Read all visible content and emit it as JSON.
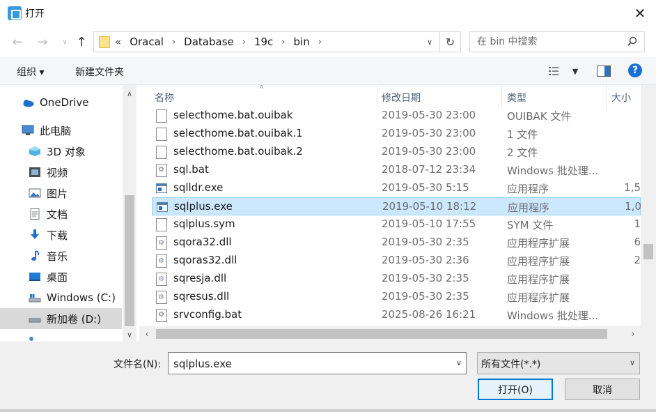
{
  "window": {
    "title": "打开"
  },
  "nav": {
    "breadcrumbs": [
      "«",
      "Oracal",
      "Database",
      "19c",
      "bin"
    ],
    "search_placeholder": "在 bin 中搜索"
  },
  "toolbar": {
    "organize_label": "组织 ▾",
    "new_folder_label": "新建文件夹",
    "help_label": "?"
  },
  "sidebar": {
    "items": [
      {
        "label": "OneDrive",
        "icon": "cloud-icon",
        "color": "#1f6fd1"
      },
      {
        "label": "此电脑",
        "icon": "computer-icon",
        "color": "#4a8bd6"
      },
      {
        "label": "3D 对象",
        "icon": "3d-objects-icon",
        "color": "#4fb3e8"
      },
      {
        "label": "视频",
        "icon": "video-icon",
        "color": "#5b5b5b"
      },
      {
        "label": "图片",
        "icon": "pictures-icon",
        "color": "#7a9ab8"
      },
      {
        "label": "文档",
        "icon": "documents-icon",
        "color": "#8a9bb0"
      },
      {
        "label": "下载",
        "icon": "downloads-icon",
        "color": "#1f6fd1"
      },
      {
        "label": "音乐",
        "icon": "music-icon",
        "color": "#1f6fd1"
      },
      {
        "label": "桌面",
        "icon": "desktop-icon",
        "color": "#1f7fd8"
      },
      {
        "label": "Windows (C:)",
        "icon": "drive-c-icon",
        "color": "#7a8a99"
      },
      {
        "label": "新加卷 (D:)",
        "icon": "drive-d-icon",
        "color": "#6a6a6a"
      }
    ]
  },
  "columns": {
    "name": "名称",
    "date": "修改日期",
    "type": "类型",
    "size": "大小"
  },
  "files": [
    {
      "name": "selecthome.bat.ouibak",
      "date": "2019-05-30 23:00",
      "type": "OUIBAK 文件",
      "size": "",
      "icon": "doc"
    },
    {
      "name": "selecthome.bat.ouibak.1",
      "date": "2019-05-30 23:00",
      "type": "1 文件",
      "size": "",
      "icon": "doc"
    },
    {
      "name": "selecthome.bat.ouibak.2",
      "date": "2019-05-30 23:00",
      "type": "2 文件",
      "size": "",
      "icon": "doc"
    },
    {
      "name": "sql.bat",
      "date": "2018-07-12 23:34",
      "type": "Windows 批处理...",
      "size": "",
      "icon": "bat"
    },
    {
      "name": "sqlldr.exe",
      "date": "2019-05-30 5:15",
      "type": "应用程序",
      "size": "1,5",
      "icon": "exe"
    },
    {
      "name": "sqlplus.exe",
      "date": "2019-05-10 18:12",
      "type": "应用程序",
      "size": "1,0",
      "icon": "exe",
      "selected": true
    },
    {
      "name": "sqlplus.sym",
      "date": "2019-05-10 17:55",
      "type": "SYM 文件",
      "size": "1",
      "icon": "doc"
    },
    {
      "name": "sqora32.dll",
      "date": "2019-05-30 2:35",
      "type": "应用程序扩展",
      "size": "6",
      "icon": "dll"
    },
    {
      "name": "sqoras32.dll",
      "date": "2019-05-30 2:36",
      "type": "应用程序扩展",
      "size": "2",
      "icon": "dll"
    },
    {
      "name": "sqresja.dll",
      "date": "2019-05-30 2:35",
      "type": "应用程序扩展",
      "size": "",
      "icon": "dll"
    },
    {
      "name": "sqresus.dll",
      "date": "2019-05-30 2:35",
      "type": "应用程序扩展",
      "size": "",
      "icon": "dll"
    },
    {
      "name": "srvconfig.bat",
      "date": "2025-08-26 16:21",
      "type": "Windows 批处理...",
      "size": "",
      "icon": "bat"
    }
  ],
  "bottom": {
    "filename_label": "文件名(N):",
    "filename_value": "sqlplus.exe",
    "filter_value": "所有文件(*.*)",
    "open_label": "打开(O)",
    "cancel_label": "取消"
  }
}
